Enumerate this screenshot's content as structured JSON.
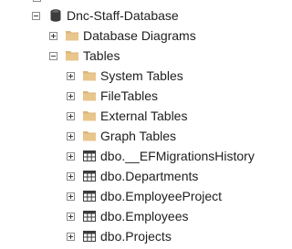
{
  "object_explorer": {
    "database": {
      "label": "Dnc-Staff-Database",
      "expanded": true,
      "icon": "database-icon"
    },
    "database_diagrams": {
      "label": "Database Diagrams",
      "expanded": false,
      "icon": "folder-icon"
    },
    "tables": {
      "label": "Tables",
      "expanded": true,
      "icon": "folder-icon",
      "items": [
        {
          "label": "System Tables",
          "icon": "folder-icon",
          "expanded": false
        },
        {
          "label": "FileTables",
          "icon": "folder-icon",
          "expanded": false
        },
        {
          "label": "External Tables",
          "icon": "folder-icon",
          "expanded": false
        },
        {
          "label": "Graph Tables",
          "icon": "folder-icon",
          "expanded": false
        },
        {
          "label": "dbo.__EFMigrationsHistory",
          "icon": "table-icon",
          "expanded": false
        },
        {
          "label": "dbo.Departments",
          "icon": "table-icon",
          "expanded": false
        },
        {
          "label": "dbo.EmployeeProject",
          "icon": "table-icon",
          "expanded": false
        },
        {
          "label": "dbo.Employees",
          "icon": "table-icon",
          "expanded": false
        },
        {
          "label": "dbo.Projects",
          "icon": "table-icon",
          "expanded": false
        }
      ]
    }
  },
  "colors": {
    "folder": "#dcb67a",
    "database": "#3c3c3c",
    "table_grid": "#3c3c3c",
    "text": "#1e1e1e"
  }
}
